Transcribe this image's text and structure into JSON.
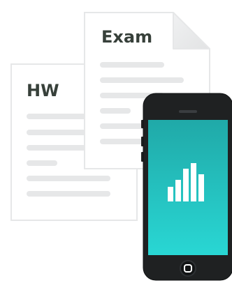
{
  "documents": [
    {
      "title": "HW",
      "line_count": 6
    },
    {
      "title": "Exam",
      "line_count": 6
    }
  ],
  "phone": {
    "screen_icon": "bar-chart-icon",
    "home_button_icon": "home-button-icon"
  },
  "colors": {
    "paper_border": "#e6e7e8",
    "paper_fill": "#ffffff",
    "paper_line": "#e6e7e8",
    "phone_body": "#1f2122",
    "screen_top": "#20a9a8",
    "screen_bottom": "#29d7d4",
    "chart_bars": "#ffffff",
    "title_text": "#37403a"
  }
}
